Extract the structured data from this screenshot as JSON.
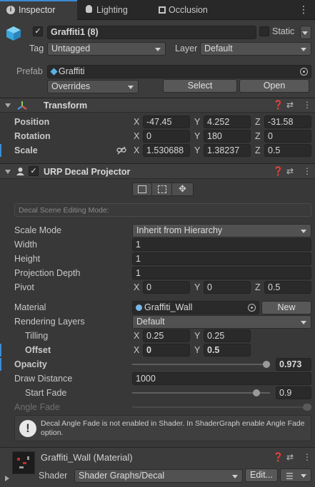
{
  "tabs": [
    {
      "label": "Inspector",
      "icon": "info-icon"
    },
    {
      "label": "Lighting",
      "icon": "lightbulb-icon"
    },
    {
      "label": "Occlusion",
      "icon": "occlusion-icon"
    }
  ],
  "object": {
    "name": "Graffiti1 (8)",
    "static_label": "Static",
    "tag_label": "Tag",
    "tag_value": "Untagged",
    "layer_label": "Layer",
    "layer_value": "Default",
    "prefab_label": "Prefab",
    "prefab_value": "Graffiti",
    "overrides_label": "Overrides",
    "select_label": "Select",
    "open_label": "Open"
  },
  "transform": {
    "title": "Transform",
    "position": {
      "label": "Position",
      "x": "-47.45",
      "y": "4.252",
      "z": "-31.58"
    },
    "rotation": {
      "label": "Rotation",
      "x": "0",
      "y": "180",
      "z": "0"
    },
    "scale": {
      "label": "Scale",
      "x": "1.530688",
      "y": "1.38237",
      "z": "0.5"
    }
  },
  "decal": {
    "title": "URP Decal Projector",
    "editing_mode": "Decal Scene Editing Mode:",
    "scale_mode": {
      "label": "Scale Mode",
      "value": "Inherit from Hierarchy"
    },
    "width": {
      "label": "Width",
      "value": "1"
    },
    "height": {
      "label": "Height",
      "value": "1"
    },
    "projection_depth": {
      "label": "Projection Depth",
      "value": "1"
    },
    "pivot": {
      "label": "Pivot",
      "x": "0",
      "y": "0",
      "z": "0.5"
    },
    "material": {
      "label": "Material",
      "value": "Graffiti_Wall",
      "new_label": "New"
    },
    "rendering_layers": {
      "label": "Rendering Layers",
      "value": "Default"
    },
    "tilling": {
      "label": "Tilling",
      "x": "0.25",
      "y": "0.25"
    },
    "offset": {
      "label": "Offset",
      "x": "0",
      "y": "0.5"
    },
    "opacity": {
      "label": "Opacity",
      "value": "0.973",
      "fraction": 0.973
    },
    "draw_distance": {
      "label": "Draw Distance",
      "value": "1000"
    },
    "start_fade": {
      "label": "Start Fade",
      "value": "0.9",
      "fraction": 0.9
    },
    "angle_fade": {
      "label": "Angle Fade"
    },
    "warning": "Decal Angle Fade is not enabled in Shader. In ShaderGraph enable Angle Fade option."
  },
  "material_section": {
    "title": "Graffiti_Wall (Material)",
    "shader_label": "Shader",
    "shader_value": "Shader Graphs/Decal",
    "edit_label": "Edit..."
  },
  "axes": {
    "x": "X",
    "y": "Y",
    "z": "Z"
  },
  "colors": {
    "accent": "#3b8bd6",
    "background": "#383838"
  }
}
